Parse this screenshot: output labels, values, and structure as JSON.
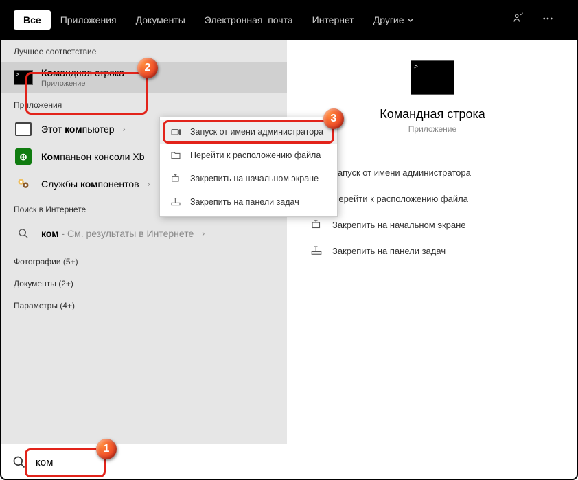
{
  "header": {
    "tabs": {
      "all": "Все",
      "apps": "Приложения",
      "documents": "Документы",
      "email": "Электронная_почта",
      "internet": "Интернет",
      "other": "Другие"
    }
  },
  "left": {
    "best_match_header": "Лучшее соответствие",
    "best_match": {
      "title_prefix": "Ком",
      "title_rest": "андная строка",
      "subtitle": "Приложение"
    },
    "apps_header": "Приложения",
    "apps": [
      {
        "prefix": "Этот ",
        "match": "ком",
        "rest": "пьютер"
      },
      {
        "prefix": "",
        "match": "Ком",
        "rest": "паньон консоли Xb"
      },
      {
        "prefix": "Службы ",
        "match": "ком",
        "rest": "понентов"
      }
    ],
    "web_header": "Поиск в Интернете",
    "web": {
      "query": "ком",
      "hint": " - См. результаты в Интернете"
    },
    "photos": "Фотографии (5+)",
    "documents": "Документы (2+)",
    "settings": "Параметры (4+)"
  },
  "right": {
    "title": "Командная строка",
    "subtitle": "Приложение",
    "actions": {
      "run_admin": "Запуск от имени администратора",
      "open_location": "Перейти к расположению файла",
      "pin_start": "Закрепить на начальном экране",
      "pin_taskbar": "Закрепить на панели задач"
    }
  },
  "context_menu": {
    "run_admin": "Запуск от имени администратора",
    "open_location": "Перейти к расположению файла",
    "pin_start": "Закрепить на начальном экране",
    "pin_taskbar": "Закрепить на панели задач"
  },
  "search": {
    "value": "ком"
  },
  "badges": {
    "b1": "1",
    "b2": "2",
    "b3": "3"
  }
}
